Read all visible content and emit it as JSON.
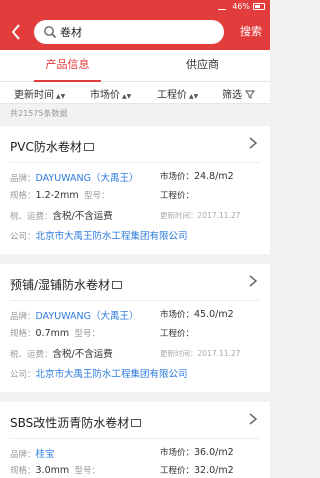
{
  "status": {
    "battery": "46%"
  },
  "search": {
    "query": "卷材",
    "button": "搜索"
  },
  "tabs": [
    {
      "label": "产品信息"
    },
    {
      "label": "供应商"
    }
  ],
  "filters": [
    {
      "label": "更新时间"
    },
    {
      "label": "市场价"
    },
    {
      "label": "工程价"
    },
    {
      "label": "筛选"
    }
  ],
  "count_text": "共21575条数据",
  "labels": {
    "brand": "品牌：",
    "market": "市场价：",
    "spec": "规格：",
    "model": "型号：",
    "eng": "工程价：",
    "tax": "税、运费：",
    "updated": "更新时间：",
    "company": "公司："
  },
  "products": [
    {
      "title": "PVC防水卷材",
      "brand": "DAYUWANG（大禹王）",
      "market_price": "24.8/m2",
      "spec": "1.2-2mm",
      "model": "",
      "eng_price": "",
      "tax": "含税/不含运费",
      "updated": "2017.11.27",
      "company": "北京市大禹王防水工程集团有限公司"
    },
    {
      "title": "预铺/湿铺防水卷材",
      "brand": "DAYUWANG（大禹王）",
      "market_price": "45.0/m2",
      "spec": "0.7mm",
      "model": "",
      "eng_price": "",
      "tax": "含税/不含运费",
      "updated": "2017.11.27",
      "company": "北京市大禹王防水工程集团有限公司"
    },
    {
      "title": "SBS改性沥青防水卷材",
      "brand": "桂宝",
      "market_price": "36.0/m2",
      "spec": "3.0mm",
      "model": "",
      "eng_price": "32.0/m2"
    }
  ]
}
